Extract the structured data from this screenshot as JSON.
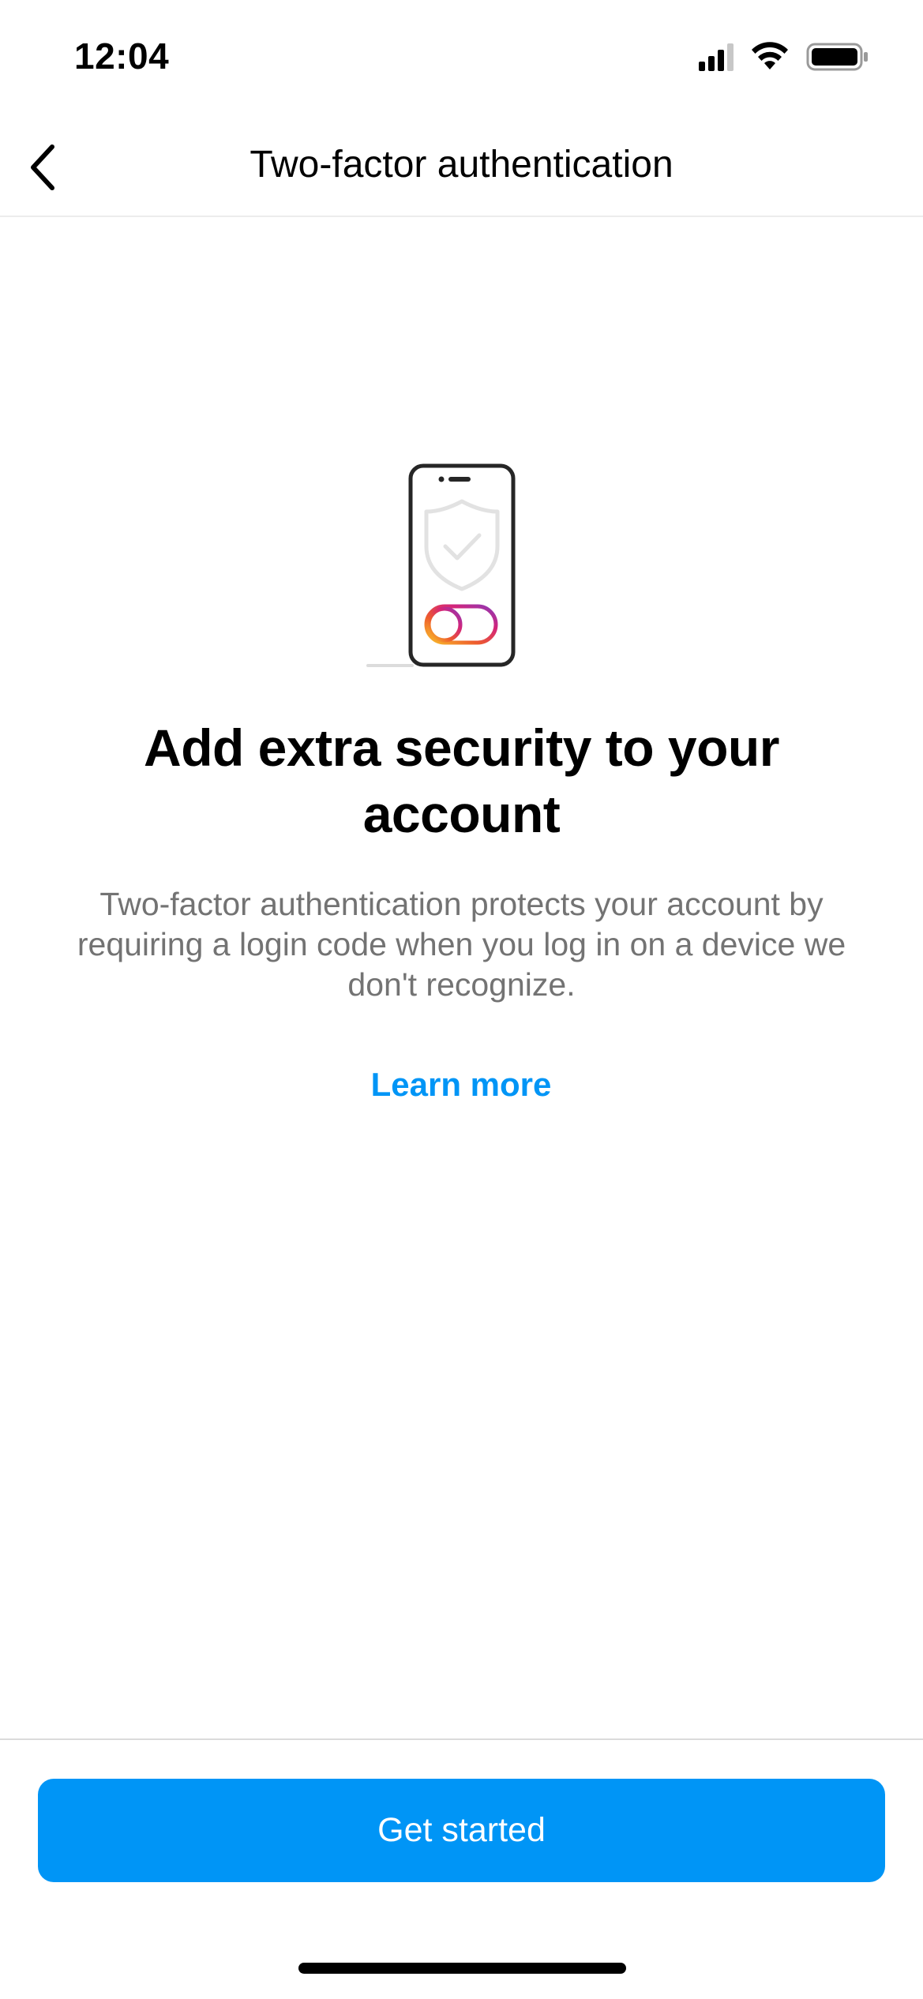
{
  "status_bar": {
    "time": "12:04",
    "icons": [
      "cellular-signal-icon",
      "wifi-icon",
      "battery-icon"
    ]
  },
  "header": {
    "title": "Two-factor authentication",
    "back_icon": "chevron-left-icon"
  },
  "illustration": {
    "icon": "phone-shield-toggle-icon"
  },
  "main": {
    "headline": "Add extra security to your account",
    "description": "Two-factor authentication protects your account by requiring a login code when you log in on a device we don't recognize.",
    "learn_more": "Learn more"
  },
  "footer": {
    "get_started_label": "Get started"
  },
  "colors": {
    "accent": "#0095f6",
    "secondary_text": "#737373",
    "divider": "#dbdbdb"
  }
}
